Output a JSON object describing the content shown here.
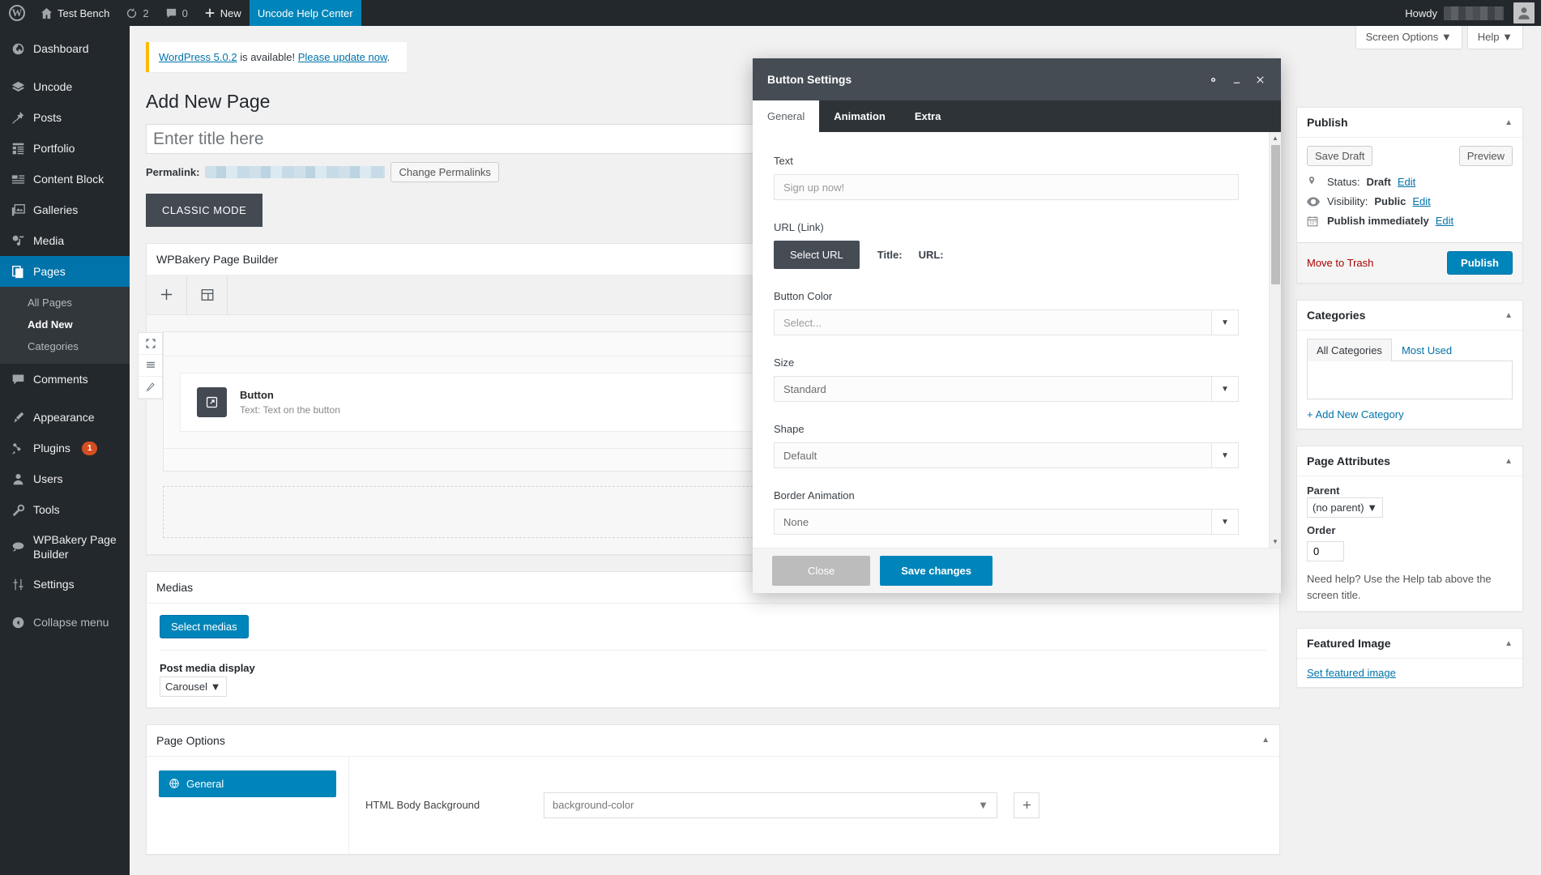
{
  "adminbar": {
    "logo_icon": "wordpress-logo-icon",
    "site_name": "Test Bench",
    "updates_icon": "updates-icon",
    "updates_count": "2",
    "comments_icon": "comments-icon",
    "comments_count": "0",
    "new_label": "New",
    "help_center_label": "Uncode Help Center",
    "howdy_label": "Howdy",
    "howdy_user_redacted": true
  },
  "sidebar": {
    "items": [
      {
        "label": "Dashboard",
        "icon": "dashboard-icon",
        "current": false
      },
      {
        "label": "Uncode",
        "icon": "layers-icon",
        "current": false
      },
      {
        "label": "Posts",
        "icon": "pin-icon",
        "current": false
      },
      {
        "label": "Portfolio",
        "icon": "portfolio-icon",
        "current": false
      },
      {
        "label": "Content Block",
        "icon": "content-block-icon",
        "current": false
      },
      {
        "label": "Galleries",
        "icon": "gallery-icon",
        "current": false
      },
      {
        "label": "Media",
        "icon": "media-icon",
        "current": false
      },
      {
        "label": "Pages",
        "icon": "pages-icon",
        "current": true
      },
      {
        "label": "Comments",
        "icon": "comments-icon",
        "current": false
      },
      {
        "label": "Appearance",
        "icon": "appearance-icon",
        "current": false
      },
      {
        "label": "Plugins",
        "icon": "plugins-icon",
        "current": false,
        "badge": "1"
      },
      {
        "label": "Users",
        "icon": "users-icon",
        "current": false
      },
      {
        "label": "Tools",
        "icon": "tools-icon",
        "current": false
      },
      {
        "label": "WPBakery Page Builder",
        "icon": "wpbakery-icon",
        "current": false
      },
      {
        "label": "Settings",
        "icon": "settings-icon",
        "current": false
      },
      {
        "label": "Collapse menu",
        "icon": "collapse-icon",
        "current": false
      }
    ],
    "submenu": [
      {
        "label": "All Pages",
        "current": false
      },
      {
        "label": "Add New",
        "current": true
      },
      {
        "label": "Categories",
        "current": false
      }
    ]
  },
  "screen_meta": {
    "screen_options": "Screen Options",
    "help": "Help",
    "caret": "▼"
  },
  "notice": {
    "link_version": "WordPress 5.0.2",
    "middle_text": " is available! ",
    "link_update": "Please update now",
    "period": "."
  },
  "page": {
    "title": "Add New Page",
    "title_placeholder": "Enter title here",
    "permalink_label": "Permalink:",
    "change_permalinks_label": "Change Permalinks",
    "classic_mode_label": "CLASSIC MODE"
  },
  "builder": {
    "panel_title": "WPBakery Page Builder",
    "toolbar": [
      {
        "icon": "plus-icon",
        "name": "add-element"
      },
      {
        "icon": "templates-icon",
        "name": "templates"
      }
    ],
    "row_controls": [
      {
        "icon": "move-icon",
        "name": "row-move"
      },
      {
        "icon": "column-layout-icon",
        "name": "row-layout"
      },
      {
        "icon": "pencil-icon",
        "name": "row-edit"
      }
    ],
    "row_add_icon": "plus-icon",
    "element": {
      "icon": "external-link-icon",
      "title": "Button",
      "subtitle": "Text: Text on the button"
    },
    "row_footer_icons": [
      "plus-icon",
      "pencil-icon",
      "close-icon"
    ],
    "empty_row_icon": "plus-icon"
  },
  "medias": {
    "panel_title": "Medias",
    "select_button": "Select medias",
    "post_media_display_label": "Post media display",
    "post_media_display_value": "Carousel",
    "caret": "▼"
  },
  "page_options": {
    "panel_title": "Page Options",
    "collapse_arrow": "▲",
    "tab_general": "General",
    "tab_general_icon": "globe-icon",
    "html_body_background_label": "HTML Body Background",
    "html_body_background_value": "background-color",
    "caret": "▼",
    "add_icon": "plus-icon"
  },
  "publish_box": {
    "title": "Publish",
    "collapse_arrow": "▲",
    "save_draft": "Save Draft",
    "preview": "Preview",
    "status_icon": "pin-marker-icon",
    "status_label": "Status:",
    "status_value": "Draft",
    "status_edit": "Edit",
    "visibility_icon": "eye-icon",
    "visibility_label": "Visibility:",
    "visibility_value": "Public",
    "visibility_edit": "Edit",
    "schedule_icon": "calendar-icon",
    "schedule_value": "Publish immediately",
    "schedule_edit": "Edit",
    "move_to_trash": "Move to Trash",
    "publish_button": "Publish"
  },
  "categories_box": {
    "title": "Categories",
    "collapse_arrow": "▲",
    "tab_all": "All Categories",
    "tab_most_used": "Most Used",
    "add_new": "+ Add New Category"
  },
  "page_attributes_box": {
    "title": "Page Attributes",
    "collapse_arrow": "▲",
    "parent_label": "Parent",
    "parent_value": "(no parent)",
    "caret": "▼",
    "order_label": "Order",
    "order_value": "0",
    "help_note": "Need help? Use the Help tab above the screen title."
  },
  "featured_image_box": {
    "title": "Featured Image",
    "collapse_arrow": "▲",
    "set_link": "Set featured image"
  },
  "modal": {
    "title": "Button Settings",
    "gear_icon": "gear-icon",
    "minimize_icon": "minimize-icon",
    "close_icon": "close-icon",
    "tabs": [
      {
        "label": "General",
        "active": true
      },
      {
        "label": "Animation",
        "active": false
      },
      {
        "label": "Extra",
        "active": false
      }
    ],
    "fields": {
      "text_label": "Text",
      "text_placeholder": "Sign up now!",
      "url_label": "URL (Link)",
      "select_url_button": "Select URL",
      "url_title_label": "Title:",
      "url_url_label": "URL:",
      "button_color_label": "Button Color",
      "button_color_value": "Select...",
      "size_label": "Size",
      "size_value": "Standard",
      "shape_label": "Shape",
      "shape_value": "Default",
      "border_animation_label": "Border Animation",
      "border_animation_value": "None"
    },
    "footer": {
      "close_button": "Close",
      "save_button": "Save changes"
    },
    "scroll_up_icon": "caret-up-icon",
    "scroll_down_icon": "caret-down-icon"
  },
  "colors": {
    "admin_dark": "#23282d",
    "admin_darker": "#32373c",
    "accent_blue": "#0085ba",
    "link_blue": "#0073aa",
    "notice_yellow": "#ffb900",
    "modal_header": "#454c54",
    "modal_tabbar": "#2e3338",
    "badge_orange": "#d54e21",
    "trash_red": "#a00"
  }
}
